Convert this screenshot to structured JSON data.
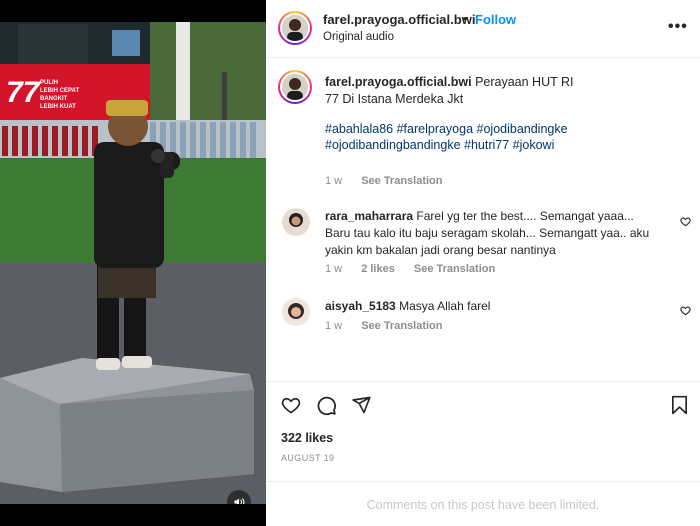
{
  "post": {
    "username": "farel.prayoga.official.bwi",
    "separator": "•",
    "follow_label": "Follow",
    "audio_label": "Original audio",
    "more_icon": "more-horizontal-icon",
    "caption": {
      "username": "farel.prayoga.official.bwi",
      "text": "Perayaan HUT RI 77 Di Istana Merdeka Jkt",
      "hashtags": "#abahlala86 #farelprayoga #ojodibandingke #ojodibandingbandingke #hutri77 #jokowi",
      "time": "1 w",
      "see_translation": "See Translation"
    },
    "comments": [
      {
        "username": "rara_maharrara",
        "text": "Farel yg ter the best.... Semangat yaaa... Baru tau kalo itu baju seragam skolah... Semangatt yaa.. aku yakin km bakalan jadi orang besar nantinya",
        "time": "1 w",
        "likes": "2 likes",
        "see_translation": "See Translation"
      },
      {
        "username": "aisyah_5183",
        "text": "Masya Allah farel",
        "time": "1 w",
        "see_translation": "See Translation"
      }
    ],
    "likes": "322 likes",
    "date": "AUGUST 19",
    "comments_limited": "Comments on this post have been limited."
  },
  "media": {
    "banner_number": "77",
    "banner_text": [
      "PULIH",
      "LEBIH CEPAT",
      "BANGKIT",
      "LEBIH KUAT"
    ],
    "sound_icon": "speaker-icon"
  },
  "colors": {
    "link": "#0095f6",
    "hashtag": "#00376b",
    "muted": "#8e8e8e",
    "banner_red": "#d3142b"
  }
}
